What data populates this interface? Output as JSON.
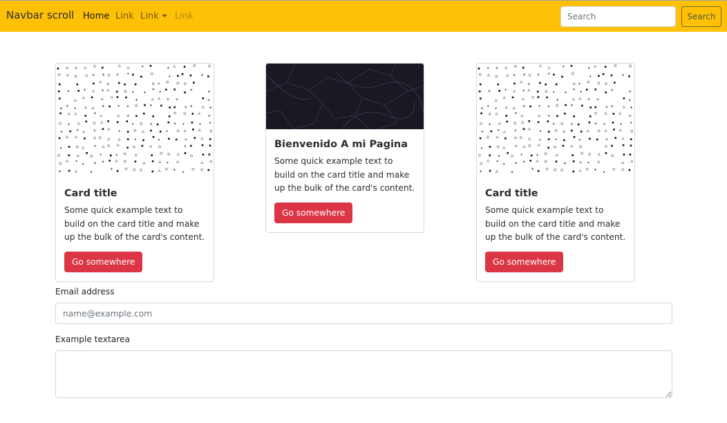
{
  "navbar": {
    "brand": "Navbar scroll",
    "links": {
      "home": "Home",
      "link": "Link",
      "dropdown": "Link",
      "disabled": "Link"
    },
    "search": {
      "placeholder": "Search",
      "button_label": "Search"
    },
    "colors": {
      "background": "#ffc107"
    }
  },
  "cards": [
    {
      "image": "pattern-dots-icon",
      "title": "Card title",
      "text": "Some quick example text to build on the card title and make up the bulk of the card's content.",
      "button_label": "Go somewhere"
    },
    {
      "image": "dark-network-image",
      "title": "Bienvenido A mi Pagina",
      "text": "Some quick example text to build on the card title and make up the bulk of the card's content.",
      "button_label": "Go somewhere"
    },
    {
      "image": "pattern-dots-icon",
      "title": "Card title",
      "text": "Some quick example text to build on the card title and make up the bulk of the card's content.",
      "button_label": "Go somewhere"
    }
  ],
  "form": {
    "email_label": "Email address",
    "email_placeholder": "name@example.com",
    "textarea_label": "Example textarea"
  },
  "colors": {
    "button": "#dc3545"
  }
}
